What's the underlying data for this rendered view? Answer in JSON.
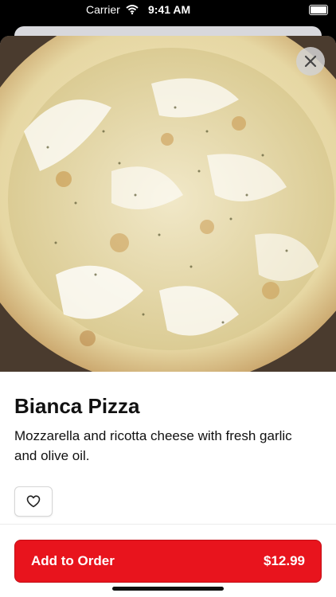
{
  "status_bar": {
    "carrier": "Carrier",
    "time": "9:41 AM"
  },
  "item": {
    "name": "Bianca Pizza",
    "description": "Mozzarella and ricotta cheese with fresh garlic and olive oil."
  },
  "actions": {
    "add_label": "Add to Order",
    "price": "$12.99"
  },
  "icons": {
    "close": "close-icon",
    "favorite": "heart-icon",
    "wifi": "wifi-icon",
    "battery": "battery-icon"
  },
  "colors": {
    "accent": "#e8141d",
    "text": "#111111"
  }
}
